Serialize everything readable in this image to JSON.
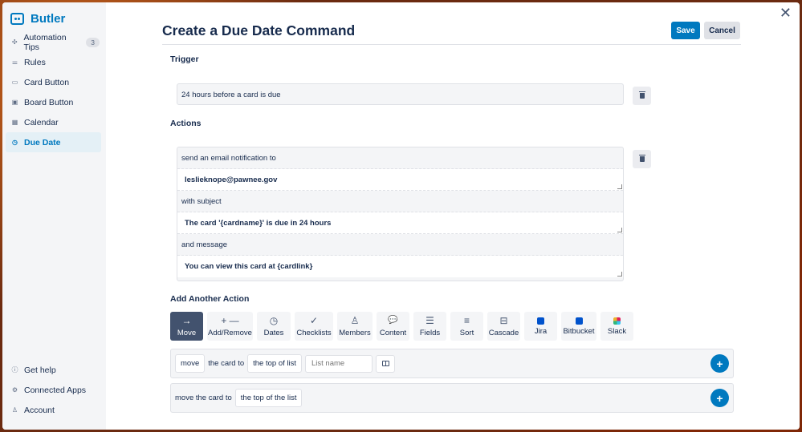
{
  "app": {
    "name": "Butler"
  },
  "sidebar": {
    "items": [
      {
        "label": "Automation Tips",
        "icon": "sparkle-icon",
        "badge": "3"
      },
      {
        "label": "Rules",
        "icon": "sliders-icon"
      },
      {
        "label": "Card Button",
        "icon": "card-icon"
      },
      {
        "label": "Board Button",
        "icon": "board-icon"
      },
      {
        "label": "Calendar",
        "icon": "calendar-icon"
      },
      {
        "label": "Due Date",
        "icon": "clock-icon",
        "active": true
      }
    ],
    "bottom": [
      {
        "label": "Get help",
        "icon": "info-icon"
      },
      {
        "label": "Connected Apps",
        "icon": "gear-icon"
      },
      {
        "label": "Account",
        "icon": "person-icon"
      }
    ]
  },
  "header": {
    "title": "Create a Due Date Command",
    "save": "Save",
    "cancel": "Cancel"
  },
  "trigger": {
    "label": "Trigger",
    "value": "24 hours before a card is due"
  },
  "actions": {
    "label": "Actions",
    "rows": [
      {
        "text": "send an email notification to",
        "input": "leslieknope@pawnee.gov"
      },
      {
        "text": "with subject",
        "input": "The card '{cardname}' is due in 24 hours"
      },
      {
        "text": "and message",
        "input": "You can view this card at {cardlink}"
      }
    ]
  },
  "add_action": {
    "label": "Add Another Action",
    "tiles": [
      {
        "label": "Move",
        "glyph": "→",
        "icon": "arrow-right-icon",
        "active": true
      },
      {
        "label": "Add/Remove",
        "glyph": "+ —",
        "icon": "add-remove-icon"
      },
      {
        "label": "Dates",
        "glyph": "◷",
        "icon": "clock-icon"
      },
      {
        "label": "Checklists",
        "glyph": "✓",
        "icon": "check-icon"
      },
      {
        "label": "Members",
        "glyph": "♙",
        "icon": "person-icon"
      },
      {
        "label": "Content",
        "glyph": "💬",
        "icon": "comment-icon"
      },
      {
        "label": "Fields",
        "glyph": "☰",
        "icon": "lines-icon"
      },
      {
        "label": "Sort",
        "glyph": "≡",
        "icon": "sort-icon"
      },
      {
        "label": "Cascade",
        "glyph": "⊟",
        "icon": "cascade-icon"
      },
      {
        "label": "Jira",
        "glyph": "",
        "icon": "jira-icon",
        "color": "#0052cc"
      },
      {
        "label": "Bitbucket",
        "glyph": "",
        "icon": "bitbucket-icon",
        "color": "#0052cc"
      },
      {
        "label": "Slack",
        "glyph": "",
        "icon": "slack-icon",
        "color": "#e01e5a"
      }
    ]
  },
  "commands": {
    "row1": {
      "verb": "move",
      "text": "the card to",
      "position": "the top of list",
      "list_placeholder": "List name"
    },
    "row2": {
      "text": "move the card to",
      "position": "the top of the list"
    }
  }
}
